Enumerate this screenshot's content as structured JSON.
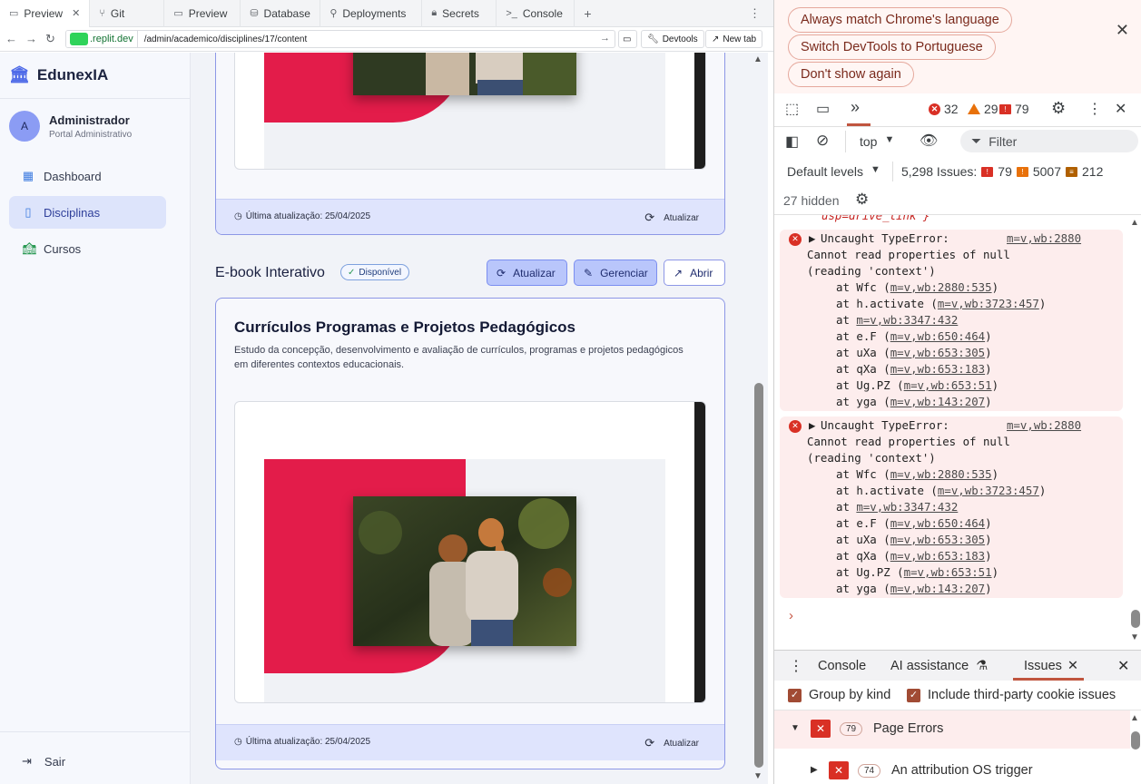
{
  "replit_tabs": [
    {
      "label": "Preview",
      "icon": "monitor-icon",
      "active": true,
      "closable": true
    },
    {
      "label": "Git",
      "icon": "git-icon"
    },
    {
      "label": "Preview",
      "icon": "monitor-icon"
    },
    {
      "label": "Database",
      "icon": "database-icon"
    },
    {
      "label": "Deployments",
      "icon": "deploy-icon"
    },
    {
      "label": "Secrets",
      "icon": "lock-icon"
    },
    {
      "label": "Console",
      "icon": "terminal-icon"
    }
  ],
  "address": {
    "host": ".replit.dev",
    "path": "/admin/academico/disciplines/17/content",
    "devtools_label": "Devtools",
    "newtab_label": "New tab"
  },
  "sidebar": {
    "brand": "EdunexIA",
    "user_initial": "A",
    "user_name": "Administrador",
    "user_role": "Portal Administrativo",
    "items": [
      {
        "label": "Dashboard",
        "icon": "grid-icon",
        "active": false
      },
      {
        "label": "Disciplinas",
        "icon": "book-icon",
        "active": true
      },
      {
        "label": "Cursos",
        "icon": "courses-icon",
        "active": false
      }
    ],
    "logout_label": "Sair"
  },
  "main": {
    "top_card_footer": {
      "updated": "Última atualização: 25/04/2025",
      "refresh_label": "Atualizar"
    },
    "section": {
      "title": "E-book Interativo",
      "badge": "Disponível",
      "btn_update": "Atualizar",
      "btn_manage": "Gerenciar",
      "btn_open": "Abrir"
    },
    "card": {
      "title": "Currículos Programas e Projetos Pedagógicos",
      "description": "Estudo da concepção, desenvolvimento e avaliação de currículos, programas e projetos pedagógicos em diferentes contextos educacionais.",
      "updated": "Última atualização: 25/04/2025",
      "refresh_label": "Atualizar"
    }
  },
  "devtools": {
    "lang_buttons": [
      "Always match Chrome's language",
      "Switch DevTools to Portuguese",
      "Don't show again"
    ],
    "error_count": "32",
    "warning_count": "29",
    "issue_count": "79",
    "context": "top",
    "filter_placeholder": "Filter",
    "levels": "Default levels",
    "issues_summary": "5,298 Issues:",
    "issues_errors": "79",
    "issues_warnings": "5007",
    "issues_info": "212",
    "hidden": "27 hidden",
    "partial_line": "usp=drive_link'}",
    "errors": [
      {
        "title": "Uncaught TypeError:",
        "source": "m=v,wb:2880",
        "msg1": "Cannot read properties of null",
        "msg2": "(reading 'context')",
        "stack": [
          {
            "fn": "at Wfc (",
            "loc": "m=v,wb:2880:535",
            "end": ")"
          },
          {
            "fn": "at h.activate (",
            "loc": "m=v,wb:3723:457",
            "end": ")"
          },
          {
            "fn": "at ",
            "loc": "m=v,wb:3347:432",
            "end": ""
          },
          {
            "fn": "at e.F (",
            "loc": "m=v,wb:650:464",
            "end": ")"
          },
          {
            "fn": "at uXa (",
            "loc": "m=v,wb:653:305",
            "end": ")"
          },
          {
            "fn": "at qXa (",
            "loc": "m=v,wb:653:183",
            "end": ")"
          },
          {
            "fn": "at Ug.PZ (",
            "loc": "m=v,wb:653:51",
            "end": ")"
          },
          {
            "fn": "at yga (",
            "loc": "m=v,wb:143:207",
            "end": ")"
          }
        ]
      },
      {
        "title": "Uncaught TypeError:",
        "source": "m=v,wb:2880",
        "msg1": "Cannot read properties of null",
        "msg2": "(reading 'context')",
        "stack": [
          {
            "fn": "at Wfc (",
            "loc": "m=v,wb:2880:535",
            "end": ")"
          },
          {
            "fn": "at h.activate (",
            "loc": "m=v,wb:3723:457",
            "end": ")"
          },
          {
            "fn": "at ",
            "loc": "m=v,wb:3347:432",
            "end": ""
          },
          {
            "fn": "at e.F (",
            "loc": "m=v,wb:650:464",
            "end": ")"
          },
          {
            "fn": "at uXa (",
            "loc": "m=v,wb:653:305",
            "end": ")"
          },
          {
            "fn": "at qXa (",
            "loc": "m=v,wb:653:183",
            "end": ")"
          },
          {
            "fn": "at Ug.PZ (",
            "loc": "m=v,wb:653:51",
            "end": ")"
          },
          {
            "fn": "at yga (",
            "loc": "m=v,wb:143:207",
            "end": ")"
          }
        ]
      }
    ],
    "drawer_tabs": {
      "console": "Console",
      "ai": "AI assistance",
      "issues": "Issues"
    },
    "group_by_kind": "Group by kind",
    "third_party": "Include third-party cookie issues",
    "issue_groups": [
      {
        "count": "79",
        "label": "Page Errors"
      },
      {
        "count": "74",
        "label": "An attribution OS trigger"
      }
    ]
  },
  "colors": {
    "accent": "#4f6be8",
    "ebook_red": "#e31c4a",
    "error_red": "#d93025",
    "devtools_accent": "#c0553f"
  }
}
